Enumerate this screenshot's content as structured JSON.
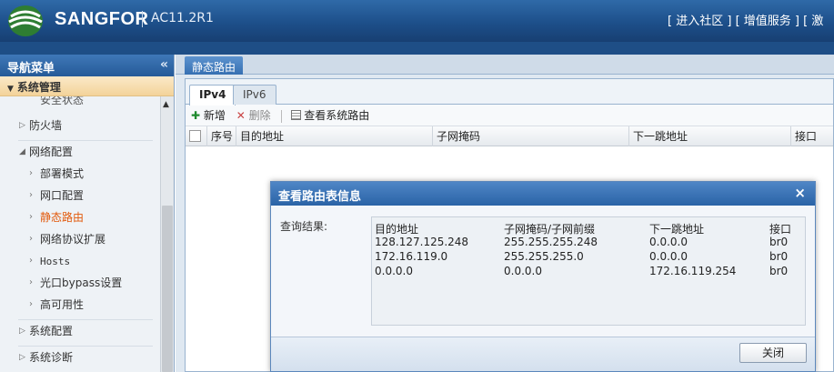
{
  "header": {
    "brand": "SANGFOR",
    "version": "AC11.2R1",
    "links": [
      "[ 进入社区 ]",
      "[ 增值服务 ]",
      "[ 激"
    ]
  },
  "sidebar": {
    "title": "导航菜单",
    "collapse_icon": "«",
    "section": "系统管理",
    "cut_item": "安全状态",
    "items": [
      {
        "label": "防火墙",
        "type": "group",
        "expanded": false
      },
      {
        "label": "网络配置",
        "type": "group",
        "expanded": true
      },
      {
        "label": "部署模式",
        "type": "sub"
      },
      {
        "label": "网口配置",
        "type": "sub"
      },
      {
        "label": "静态路由",
        "type": "sub",
        "active": true
      },
      {
        "label": "网络协议扩展",
        "type": "sub"
      },
      {
        "label": "Hosts",
        "type": "sub"
      },
      {
        "label": "光口bypass设置",
        "type": "sub"
      },
      {
        "label": "高可用性",
        "type": "sub"
      },
      {
        "label": "系统配置",
        "type": "group",
        "expanded": false
      },
      {
        "label": "系统诊断",
        "type": "group",
        "expanded": false
      }
    ]
  },
  "main": {
    "tab": "静态路由",
    "subtabs": [
      "IPv4",
      "IPv6"
    ],
    "toolbar": {
      "add": "新增",
      "delete": "删除",
      "view": "查看系统路由"
    },
    "columns": [
      "序号",
      "目的地址",
      "子网掩码",
      "下一跳地址",
      "接口"
    ]
  },
  "dialog": {
    "title": "查看路由表信息",
    "close_icon": "×",
    "query_label": "查询结果:",
    "columns": [
      "目的地址",
      "子网掩码/子网前缀",
      "下一跳地址",
      "接口"
    ],
    "rows": [
      [
        "128.127.125.248",
        "255.255.255.248",
        "0.0.0.0",
        "br0"
      ],
      [
        "172.16.119.0",
        "255.255.255.0",
        "0.0.0.0",
        "br0"
      ],
      [
        "0.0.0.0",
        "0.0.0.0",
        "172.16.119.254",
        "br0"
      ]
    ],
    "close_button": "关闭"
  },
  "colors": {
    "header_blue": "#1d4f8a",
    "active_menu": "#e2580a",
    "section_bg": "#f3d39a"
  }
}
